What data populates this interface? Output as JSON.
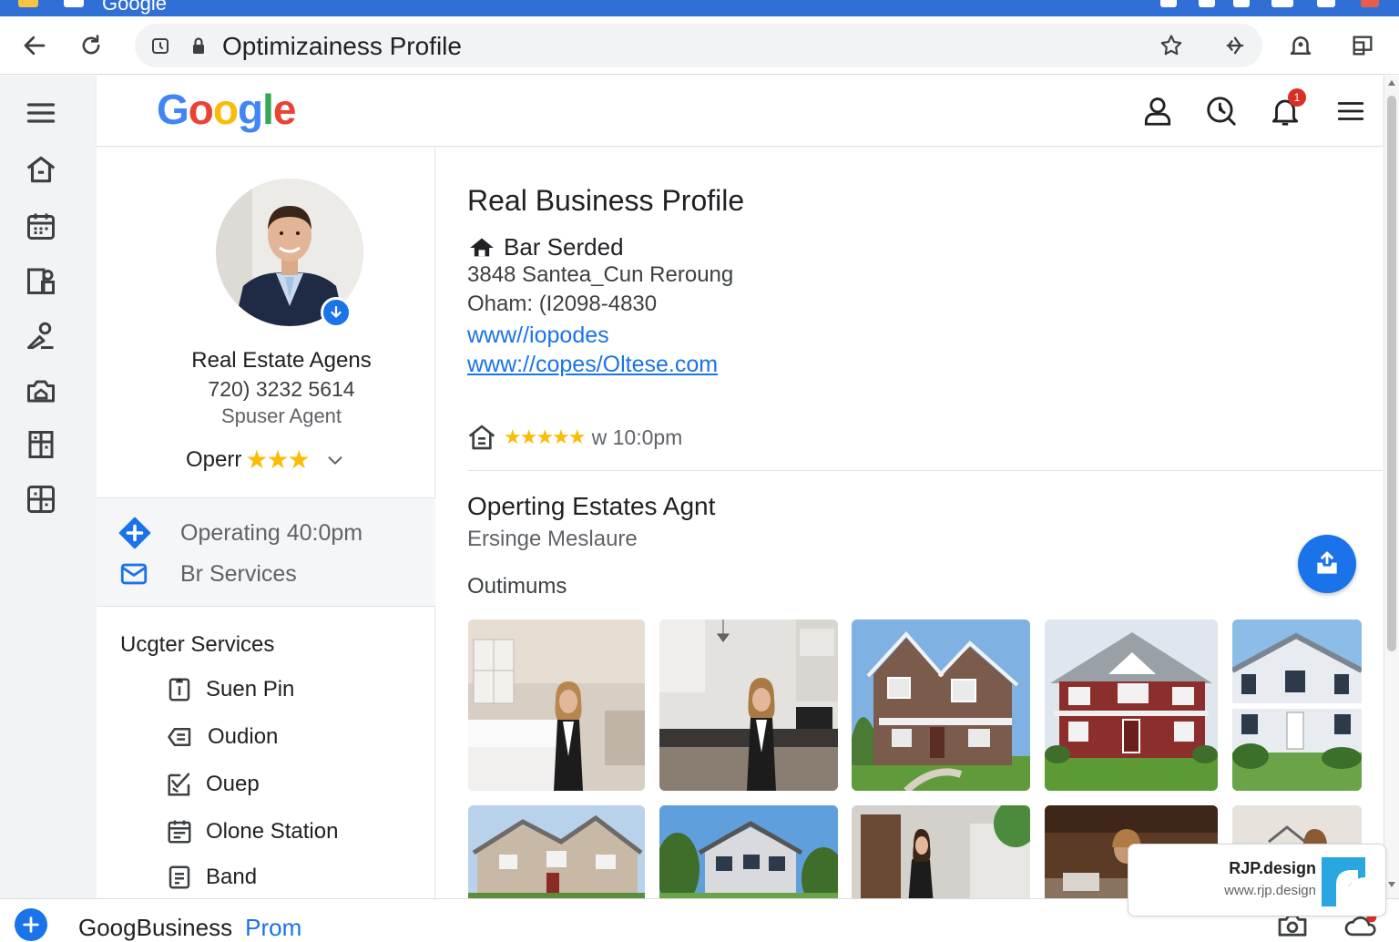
{
  "browser": {
    "tab_title": "Google",
    "url_text": "Optimizainess Profile"
  },
  "header": {
    "logo_letters": [
      "G",
      "o",
      "o",
      "g",
      "l",
      "e"
    ],
    "logo_colors": [
      "#4285F4",
      "#EA4335",
      "#FBBC05",
      "#4285F4",
      "#34A853",
      "#EA4335"
    ],
    "notification_count": "1"
  },
  "profile": {
    "name": "Real Estate Agens",
    "phone": "720) 3232 5614",
    "role": "Spuser Agent",
    "open_label": "Operr",
    "stars": "★★★",
    "hours_text": "Operating 40:0pm",
    "services_link": "Br Services"
  },
  "services": {
    "title": "Ucgter Services",
    "items": [
      {
        "label": "Suen Pin",
        "icon": "info-box-icon"
      },
      {
        "label": "Oudion",
        "icon": "chat-bubble-icon"
      },
      {
        "label": "Ouep",
        "icon": "checklist-icon"
      },
      {
        "label": "Olone Station",
        "icon": "calendar-grid-icon"
      },
      {
        "label": "Band",
        "icon": "document-icon"
      }
    ]
  },
  "business": {
    "title": "Real Business Profile",
    "name": "Bar Serded",
    "address": "3848 Santea_Cun Reroung",
    "phone": "Oham: (I2098-4830",
    "website1": "www//iopodes",
    "website2": "www://copes/Oltese.com",
    "rating_stars": "★★★★★",
    "rating_text": "w  10:0pm",
    "section_title": "Operting Estates Agnt",
    "section_subtitle": "Ersinge Meslaure",
    "photos_label": "Outimums"
  },
  "bottom": {
    "text": "GoogBusiness",
    "link": "Prom"
  },
  "watermark": {
    "name": "RJP.design",
    "url": "www.rjp.design"
  },
  "colors": {
    "accent": "#1a73e8",
    "star": "#fbbc04",
    "chrome_blue": "#2f6fd6"
  }
}
